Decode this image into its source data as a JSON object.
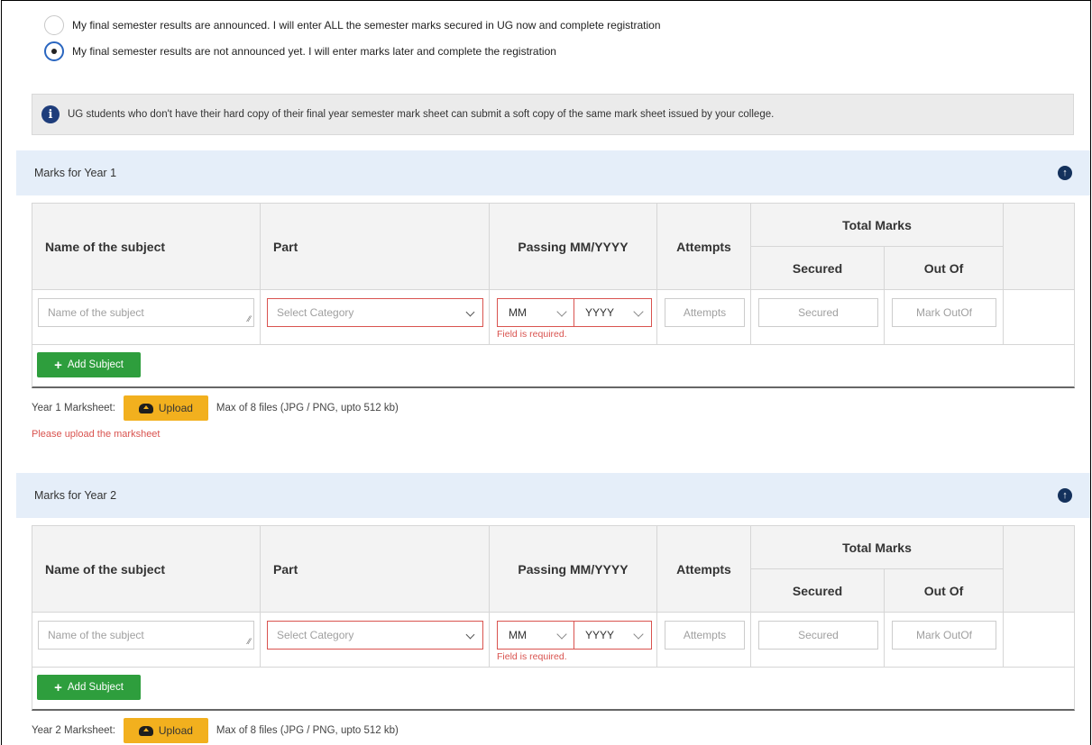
{
  "options": {
    "announced_label": "My final semester results are announced. I will enter ALL the semester marks secured in UG now and complete registration",
    "not_announced_label": "My final semester results are not announced yet. I will enter marks later and complete the registration"
  },
  "info": {
    "text": "UG students who don't have their hard copy of their final year semester mark sheet can submit a soft copy of the same mark sheet issued by your college."
  },
  "table_headers": {
    "subject": "Name of the subject",
    "part": "Part",
    "passing": "Passing MM/YYYY",
    "attempts": "Attempts",
    "total_marks": "Total Marks",
    "secured": "Secured",
    "out_of": "Out Of"
  },
  "row_fields": {
    "subject_placeholder": "Name of the subject",
    "part_placeholder": "Select Category",
    "month": "MM",
    "year": "YYYY",
    "attempts_placeholder": "Attempts",
    "secured_placeholder": "Secured",
    "out_of_placeholder": "Mark OutOf",
    "field_error": "Field is required."
  },
  "add_subject_label": "Add Subject",
  "upload": {
    "button_label": "Upload",
    "limit_text": "Max of 8 files (JPG / PNG, upto 512 kb)",
    "error_text": "Please upload the marksheet"
  },
  "years": [
    {
      "title": "Marks for Year 1",
      "marksheet_label": "Year 1 Marksheet:"
    },
    {
      "title": "Marks for Year 2",
      "marksheet_label": "Year 2 Marksheet:"
    }
  ],
  "colors": {
    "accent_blue": "#1e3d7b",
    "header_bg": "#e5eef9",
    "error_red": "#d9534f",
    "add_green": "#2e9e3d",
    "upload_yellow": "#f2b01e"
  }
}
